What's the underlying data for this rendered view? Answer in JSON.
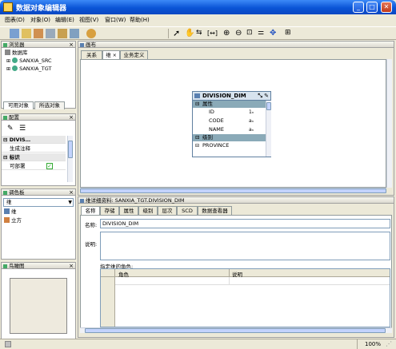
{
  "window": {
    "title": "数据对象编辑器"
  },
  "menu": [
    "图表(D)",
    "对象(O)",
    "编辑(E)",
    "视图(V)",
    "窗口(W)",
    "帮助(H)"
  ],
  "browser": {
    "title": "浏览器",
    "tree": [
      "数据库",
      "SANXIA_SRC",
      "SANXIA_TGT"
    ],
    "tabs": [
      "可用对象",
      "所选对象"
    ]
  },
  "config": {
    "title": "配置",
    "rows": [
      {
        "label": "DIVIS…",
        "group": true
      },
      {
        "label": "生成注释",
        "group": false
      },
      {
        "label": "标识",
        "group": true
      },
      {
        "label": "可部署",
        "group": false,
        "checked": true
      }
    ]
  },
  "palette": {
    "title": "调色板",
    "selected": "维",
    "items": [
      "维",
      "立方"
    ]
  },
  "birdseye": {
    "title": "鸟瞰图"
  },
  "canvas": {
    "title": "画布",
    "tabs": [
      "关系",
      "维",
      "业务定义"
    ],
    "tab_close": "×",
    "dimension": {
      "name": "DIVISION_DIM",
      "sections": [
        {
          "label": "属性",
          "rows": [
            {
              "name": "ID",
              "type": "1ₙ"
            },
            {
              "name": "CODE",
              "type": "aₙ"
            },
            {
              "name": "NAME",
              "type": "aₙ"
            }
          ]
        },
        {
          "label": "级别",
          "rows": [
            {
              "name": "PROVINCE",
              "type": ""
            }
          ]
        }
      ]
    }
  },
  "details": {
    "title": "维详细资料: SANXIA_TGT.DIVISION_DIM",
    "tabs": [
      "名称",
      "存储",
      "属性",
      "级别",
      "层次",
      "SCD",
      "数据查看器"
    ],
    "name_label": "名称:",
    "name_value": "DIVISION_DIM",
    "desc_label": "说明:",
    "roles_label": "指定维的角色:",
    "roles_columns": [
      "角色",
      "说明"
    ]
  },
  "status": {
    "zoom": "100%"
  }
}
